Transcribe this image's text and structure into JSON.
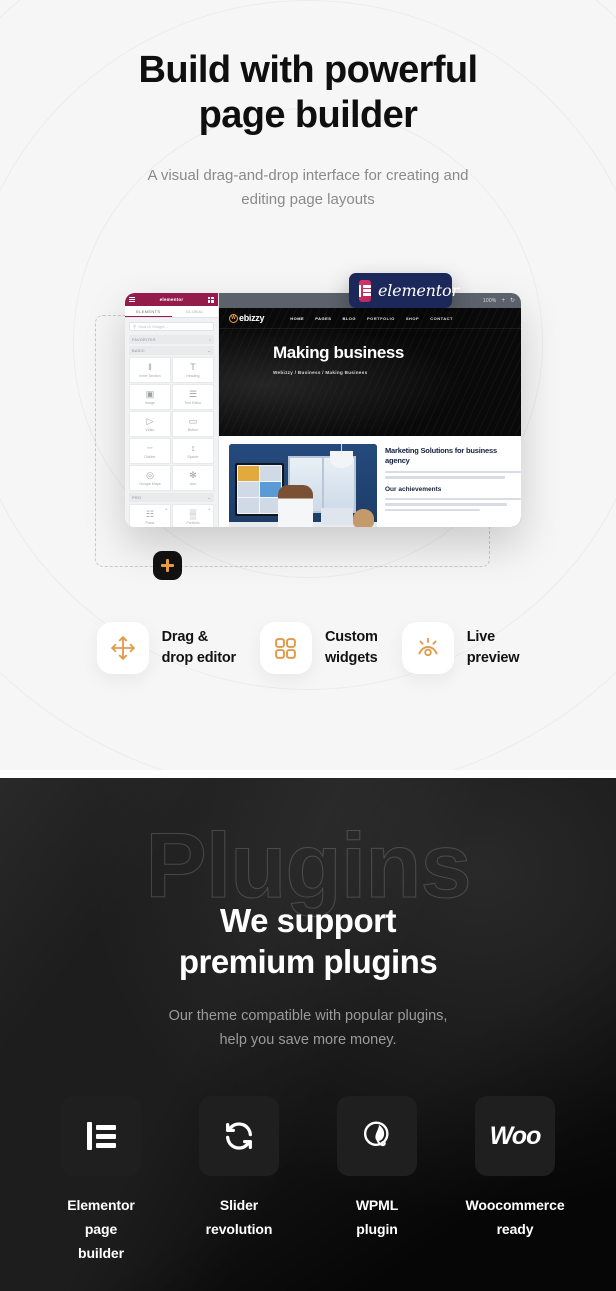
{
  "builder": {
    "title_line1": "Build with powerful",
    "title_line2": "page builder",
    "subtitle_line1": "A visual drag-and-drop interface for creating and",
    "subtitle_line2": "editing page layouts",
    "badge": {
      "word": "elementor"
    },
    "add_button": "+",
    "browser": {
      "zoom": "100%",
      "plus": "+",
      "reload": "↻"
    },
    "panel": {
      "brand": "elementor",
      "tabs": [
        "ELEMENTS",
        "GLOBAL"
      ],
      "search_placeholder": "Search Widget...",
      "categories": [
        "FAVORITES",
        "BASIC",
        "PRO"
      ],
      "widgets": [
        {
          "label": "Inner Section",
          "icon": "‖"
        },
        {
          "label": "Heading",
          "icon": "T"
        },
        {
          "label": "Image",
          "icon": "▣"
        },
        {
          "label": "Text Editor",
          "icon": "☰"
        },
        {
          "label": "Video",
          "icon": "▷"
        },
        {
          "label": "Button",
          "icon": "▭"
        },
        {
          "label": "Divider",
          "icon": "┄"
        },
        {
          "label": "Spacer",
          "icon": "↕"
        },
        {
          "label": "Google Maps",
          "icon": "◎"
        },
        {
          "label": "Icon",
          "icon": "✻"
        }
      ],
      "pro_widgets": [
        {
          "label": "Posts",
          "icon": "☷"
        },
        {
          "label": "Portfolio",
          "icon": "▒"
        }
      ]
    },
    "site": {
      "logo_mark": "W",
      "logo_text": "ebizzy",
      "menu": [
        "HOME",
        "PAGES",
        "BLOG",
        "PORTFOLIO",
        "SHOP",
        "CONTACT"
      ],
      "hero_title": "Making business",
      "breadcrumb": "Webizzy / Business / Making Business",
      "content_heading": "Marketing Solutions for business agency",
      "content_subheading": "Our achievements"
    },
    "features": [
      {
        "label_line1": "Drag &",
        "label_line2": "drop editor",
        "icon": "move-arrows-icon"
      },
      {
        "label_line1": "Custom",
        "label_line2": "widgets",
        "icon": "four-squares-icon"
      },
      {
        "label_line1": "Live",
        "label_line2": "preview",
        "icon": "eye-rays-icon"
      }
    ]
  },
  "plugins": {
    "watermark": "Plugins",
    "title_line1": "We support",
    "title_line2": "premium plugins",
    "subtitle_line1": "Our theme compatible with popular plugins,",
    "subtitle_line2": "help you save more money.",
    "cards": [
      {
        "label_line1": "Elementor page",
        "label_line2": "builder",
        "icon": "elementor-icon"
      },
      {
        "label_line1": "Slider",
        "label_line2": "revolution",
        "icon": "refresh-cycle-icon"
      },
      {
        "label_line1": "WPML",
        "label_line2": "plugin",
        "icon": "wpml-globe-icon"
      },
      {
        "label_line1": "Woocommerce",
        "label_line2": "ready",
        "icon": "woo-icon"
      }
    ]
  },
  "colors": {
    "accent_orange": "#e59b42",
    "elementor_navy": "#1c2859",
    "elementor_pink": "#d9356a",
    "panel_maroon": "#941c4d",
    "light_bg": "#f6f6f6",
    "dark_bg": "#060606"
  }
}
